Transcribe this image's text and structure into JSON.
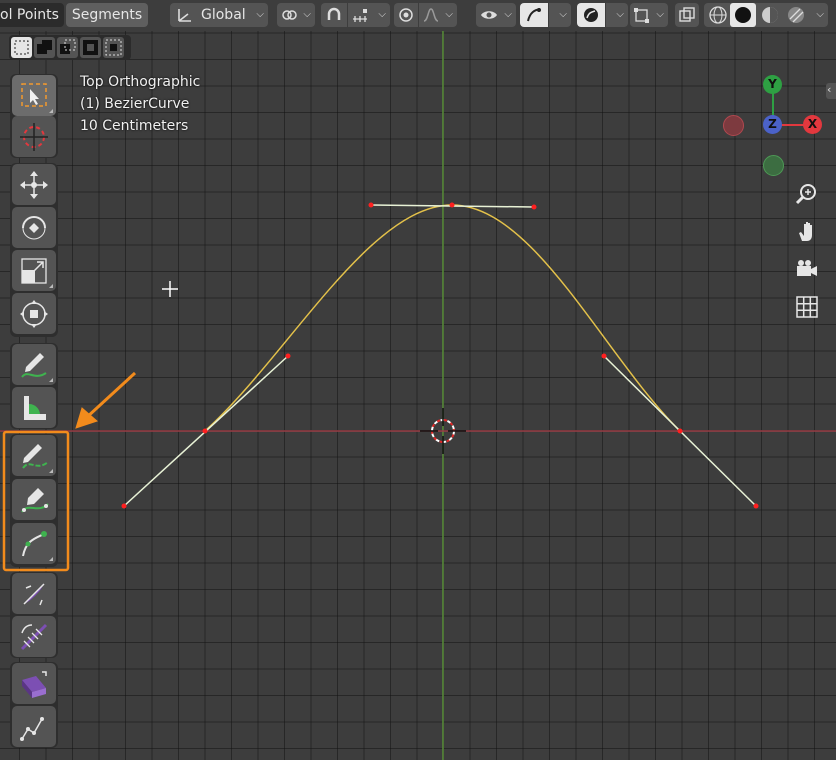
{
  "header": {
    "mode_partial": "ol Points",
    "segments": "Segments",
    "orientation": "Global"
  },
  "overlay": {
    "view_name": "Top Orthographic",
    "object_name": "(1) BezierCurve",
    "scale_text": "10 Centimeters"
  },
  "gizmo": {
    "y": "Y",
    "z": "Z",
    "x": "X"
  },
  "colors": {
    "highlight": "#f28b1c",
    "curve": "#e3c14a",
    "handle": "#e8f2d6",
    "control_point": "#ff2020",
    "axis_x": "#e2383e",
    "axis_y": "#2ea043",
    "axis_z": "#4b62c8"
  },
  "toolbar": {
    "tools": [
      "select-box",
      "cursor",
      "move",
      "rotate",
      "scale",
      "transform",
      "annotate",
      "measure",
      "draw",
      "pen",
      "curve-pen",
      "tilt",
      "radius",
      "extrude",
      "randomize"
    ]
  }
}
